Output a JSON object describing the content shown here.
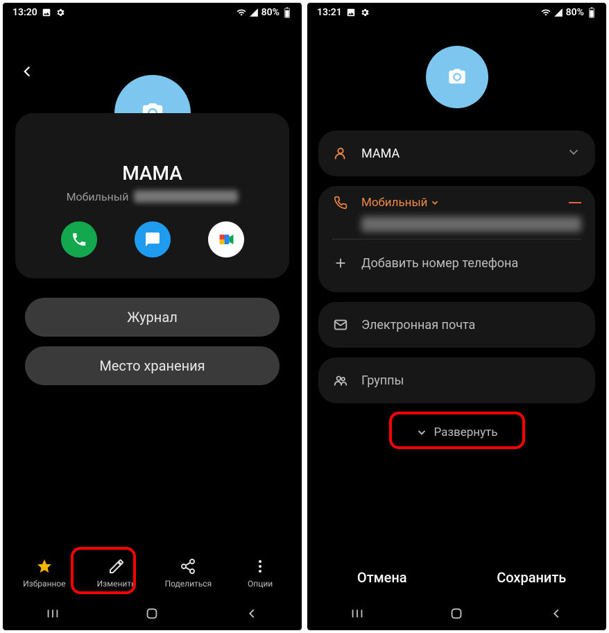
{
  "left": {
    "status": {
      "time": "13:20",
      "battery": "80%"
    },
    "contact_name": "МАМА",
    "phone_type": "Мобильный",
    "buttons": {
      "journal": "Журнал",
      "storage": "Место хранения"
    },
    "bottom": {
      "favorite": "Избранное",
      "edit": "Изменить",
      "share": "Поделиться",
      "options": "Опции"
    }
  },
  "right": {
    "status": {
      "time": "13:21",
      "battery": "80%"
    },
    "name_value": "МАМА",
    "phone_type": "Мобильный",
    "add_phone": "Добавить номер телефона",
    "email": "Электронная почта",
    "groups": "Группы",
    "expand": "Развернуть",
    "cancel": "Отмена",
    "save": "Сохранить"
  }
}
